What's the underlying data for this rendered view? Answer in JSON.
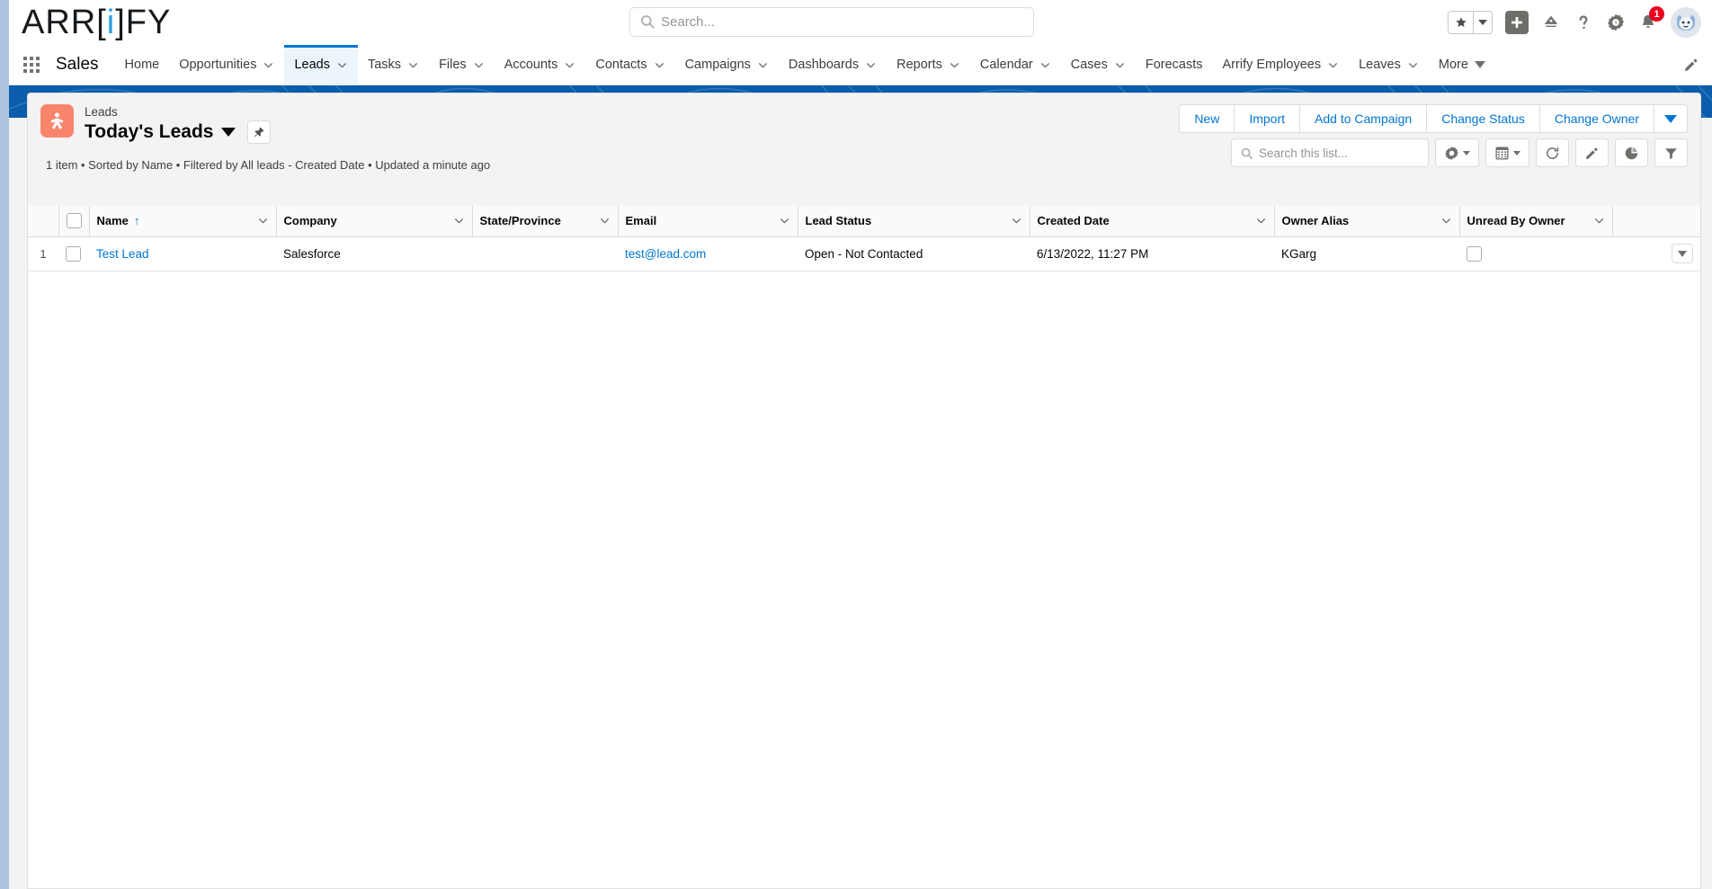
{
  "brand": {
    "pre": "ARR[",
    "accent": "i",
    "post": "]FY"
  },
  "global_search": {
    "placeholder": "Search...",
    "value": "",
    "icon": "search-icon"
  },
  "header_icons": {
    "favorites": "star-icon",
    "favorites_caret": "chevron-down-icon",
    "add": "plus-icon",
    "einstein": "einstein-icon",
    "help": "question-mark-icon",
    "setup": "gear-icon",
    "notifications": "bell-icon",
    "notifications_count": "1",
    "avatar": "avatar"
  },
  "app_nav": {
    "waffle": "app-launcher-icon",
    "app_name": "Sales",
    "edit_icon": "pencil-icon",
    "items": [
      {
        "label": "Home",
        "caret": false,
        "active": false
      },
      {
        "label": "Opportunities",
        "caret": true,
        "active": false
      },
      {
        "label": "Leads",
        "caret": true,
        "active": true
      },
      {
        "label": "Tasks",
        "caret": true,
        "active": false
      },
      {
        "label": "Files",
        "caret": true,
        "active": false
      },
      {
        "label": "Accounts",
        "caret": true,
        "active": false
      },
      {
        "label": "Contacts",
        "caret": true,
        "active": false
      },
      {
        "label": "Campaigns",
        "caret": true,
        "active": false
      },
      {
        "label": "Dashboards",
        "caret": true,
        "active": false
      },
      {
        "label": "Reports",
        "caret": true,
        "active": false
      },
      {
        "label": "Calendar",
        "caret": true,
        "active": false
      },
      {
        "label": "Cases",
        "caret": true,
        "active": false
      },
      {
        "label": "Forecasts",
        "caret": false,
        "active": false
      },
      {
        "label": "Arrify Employees",
        "caret": true,
        "active": false
      },
      {
        "label": "Leaves",
        "caret": true,
        "active": false
      },
      {
        "label": "More",
        "caret": true,
        "active": false
      }
    ]
  },
  "list_page": {
    "object_label": "Leads",
    "list_view_name": "Today's Leads",
    "list_view_caret": "chevron-down-icon",
    "object_icon": "lead-person-icon",
    "pin_icon": "pin-icon",
    "meta": "1 item • Sorted by Name • Filtered by All leads - Created Date • Updated a minute ago",
    "actions": [
      {
        "label": "New"
      },
      {
        "label": "Import"
      },
      {
        "label": "Add to Campaign"
      },
      {
        "label": "Change Status"
      },
      {
        "label": "Change Owner"
      }
    ],
    "actions_more_icon": "caret-down-icon",
    "search": {
      "placeholder": "Search this list...",
      "value": "",
      "icon": "search-icon"
    },
    "controls": [
      {
        "name": "list-view-controls",
        "icon": "gear-icon",
        "caret": true
      },
      {
        "name": "display-as",
        "icon": "table-icon",
        "caret": true
      },
      {
        "name": "refresh",
        "icon": "refresh-icon",
        "caret": false
      },
      {
        "name": "edit-list",
        "icon": "pencil-icon",
        "caret": false
      },
      {
        "name": "charts",
        "icon": "chart-pie-icon",
        "caret": false
      },
      {
        "name": "filters",
        "icon": "filter-funnel-icon",
        "caret": false
      }
    ]
  },
  "table": {
    "select_all_checkbox": false,
    "columns": [
      {
        "label": "Name",
        "sorted": "asc",
        "caret": true
      },
      {
        "label": "Company",
        "sorted": "",
        "caret": true
      },
      {
        "label": "State/Province",
        "sorted": "",
        "caret": true
      },
      {
        "label": "Email",
        "sorted": "",
        "caret": true
      },
      {
        "label": "Lead Status",
        "sorted": "",
        "caret": true
      },
      {
        "label": "Created Date",
        "sorted": "",
        "caret": true
      },
      {
        "label": "Owner Alias",
        "sorted": "",
        "caret": true
      },
      {
        "label": "Unread By Owner",
        "sorted": "",
        "caret": true
      }
    ],
    "rows": [
      {
        "index": "1",
        "selected": false,
        "name": "Test Lead",
        "company": "Salesforce",
        "state": "",
        "email": "test@lead.com",
        "lead_status": "Open - Not Contacted",
        "created_date": "6/13/2022, 11:27 PM",
        "owner_alias": "KGarg",
        "unread_by_owner": false
      }
    ]
  },
  "colors": {
    "brand_blue": "#0176d3",
    "band_blue": "#0b5cab",
    "lead_orange": "#f8846c",
    "badge_red": "#ea001e",
    "link_blue": "#0176d3"
  }
}
